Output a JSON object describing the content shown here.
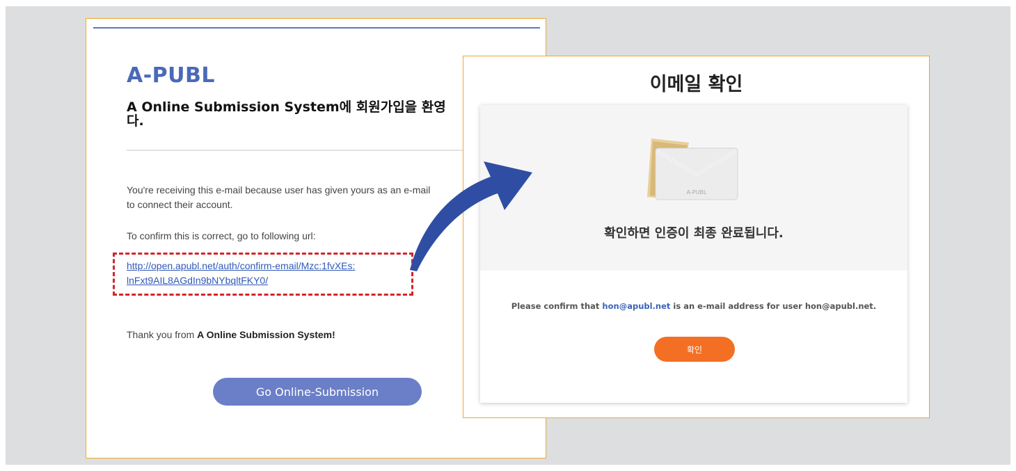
{
  "email": {
    "brand": "A-PUBL",
    "welcome_bold": "A Online Submission System",
    "welcome_rest": "에 회원가입을 환영",
    "welcome_line2": "다.",
    "receiving_text": "You're receiving this e-mail because user has given yours as an e-mail",
    "receiving_text2": "to connect their account.",
    "confirm_prompt": "To confirm this is correct, go to following url:",
    "link_line1": "http://open.apubl.net/auth/confirm-email/Mzc:1fvXEs:",
    "link_line2": "lnFxt9AIL8AGdIn9bNYbqltFKY0/",
    "thanks_prefix": "Thank you from ",
    "thanks_bold": "A Online Submission System!",
    "button_label": "Go Online-Submission"
  },
  "confirm": {
    "title": "이메일 확인",
    "envelope_label": "A-PUBL",
    "message": "확인하면 인증이 최종 완료됩니다.",
    "line_prefix": "Please confirm that ",
    "line_email": "hon@apubl.net",
    "line_suffix": " is an e-mail address for user hon@apubl.net.",
    "button_label": "확인"
  },
  "colors": {
    "brand_blue": "#4a69b8",
    "link_blue": "#2f58b9",
    "dashed_red": "#d5232a",
    "panel_border": "#f0a830",
    "arrow_blue": "#2f4ea3",
    "ok_orange": "#f36f23",
    "go_button": "#6a7fc7"
  }
}
